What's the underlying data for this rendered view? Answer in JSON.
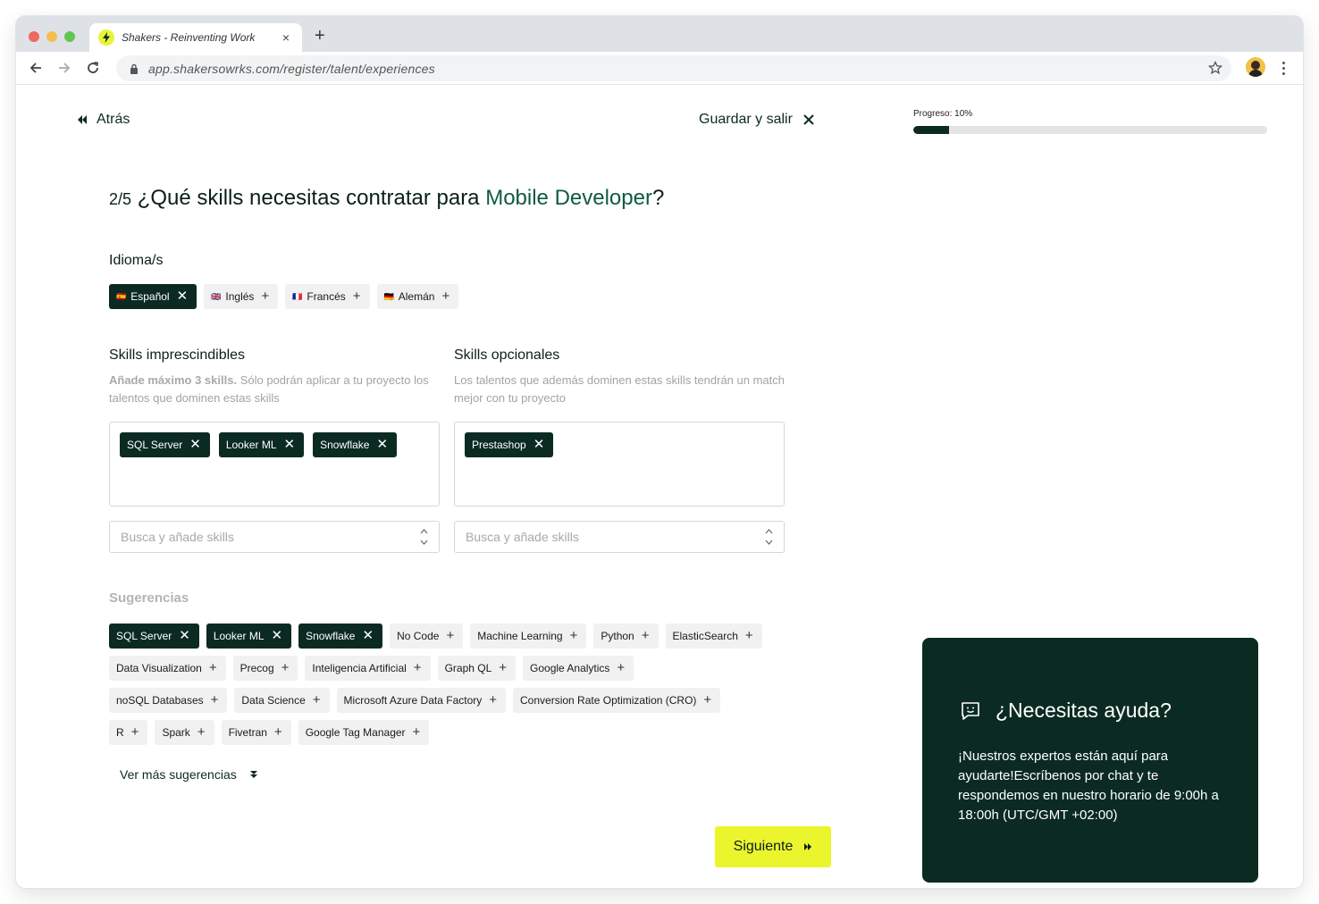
{
  "browser": {
    "tab_title": "Shakers - Reinventing Work",
    "tab_close": "×",
    "new_tab": "+",
    "url": "app.shakersowrks.com/register/talent/experiences"
  },
  "header": {
    "back_label": "Atrás",
    "save_exit_label": "Guardar y salir",
    "progress_label": "Progreso: 10%",
    "progress_value": 0.1
  },
  "question": {
    "step": "2/5",
    "text": "¿Qué skills necesitas contratar para",
    "role": "Mobile Developer",
    "suffix": "?"
  },
  "languages": {
    "label": "Idioma/s",
    "items": [
      {
        "flag": "🇪🇸",
        "label": "Español",
        "selected": true
      },
      {
        "flag": "🇬🇧",
        "label": "Inglés",
        "selected": false
      },
      {
        "flag": "🇫🇷",
        "label": "Francés",
        "selected": false
      },
      {
        "flag": "🇩🇪",
        "label": "Alemán",
        "selected": false
      }
    ]
  },
  "required_skills": {
    "label": "Skills imprescindibles",
    "hint_bold": "Añade máximo 3 skills.",
    "hint_text": " Sólo podrán aplicar a tu proyecto los talentos que dominen estas skills",
    "selected": [
      "SQL Server",
      "Looker ML",
      "Snowflake"
    ],
    "search_placeholder": "Busca y añade skills"
  },
  "optional_skills": {
    "label": "Skills opcionales",
    "hint_text": "Los talentos que además dominen estas skills tendrán un match mejor con tu proyecto",
    "selected": [
      "Prestashop"
    ],
    "search_placeholder": "Busca y añade skills"
  },
  "suggestions": {
    "label": "Sugerencias",
    "rows": [
      [
        {
          "label": "SQL Server",
          "selected": true
        },
        {
          "label": "Looker ML",
          "selected": true
        },
        {
          "label": "Snowflake",
          "selected": true
        },
        {
          "label": "No Code",
          "selected": false
        },
        {
          "label": "Machine Learning",
          "selected": false
        },
        {
          "label": "Python",
          "selected": false
        },
        {
          "label": "ElasticSearch",
          "selected": false
        }
      ],
      [
        {
          "label": "Data Visualization",
          "selected": false
        },
        {
          "label": "Precog",
          "selected": false
        },
        {
          "label": "Inteligencia Artificial",
          "selected": false
        },
        {
          "label": "Graph QL",
          "selected": false
        },
        {
          "label": "Google Analytics",
          "selected": false
        }
      ],
      [
        {
          "label": "noSQL Databases",
          "selected": false
        },
        {
          "label": "Data Science",
          "selected": false
        },
        {
          "label": "Microsoft Azure Data Factory",
          "selected": false
        },
        {
          "label": "Conversion Rate Optimization (CRO)",
          "selected": false
        }
      ],
      [
        {
          "label": "R",
          "selected": false
        },
        {
          "label": "Spark",
          "selected": false
        },
        {
          "label": "Fivetran",
          "selected": false
        },
        {
          "label": "Google Tag Manager",
          "selected": false
        }
      ]
    ],
    "more_label": "Ver más sugerencias"
  },
  "next_label": "Siguiente",
  "help": {
    "title": "¿Necesitas ayuda?",
    "body": "¡Nuestros expertos están aquí para ayudarte!Escríbenos por chat y te respondemos en nuestro horario de 9:00h a 18:00h (UTC/GMT +02:00)"
  },
  "colors": {
    "brand_dark": "#0b2b22",
    "accent_yellow": "#ebf52e",
    "role_green": "#0f5a45"
  }
}
